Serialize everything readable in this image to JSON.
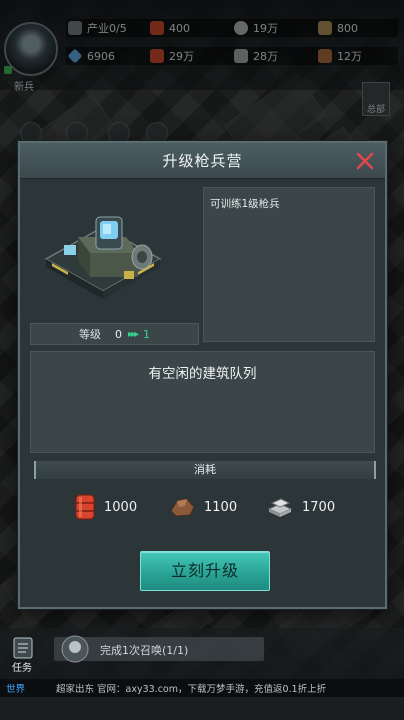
{
  "hud": {
    "avatar_label": "新兵",
    "resources_row1": [
      {
        "icon": "industry-icon",
        "value": "产业0/5",
        "color": "#9aa6a8"
      },
      {
        "icon": "oil-icon",
        "value": "400",
        "color": "#c9492e"
      },
      {
        "icon": "ore-icon",
        "value": "19万",
        "color": "#b0b4b2"
      },
      {
        "icon": "supply-icon",
        "value": "800",
        "color": "#a98c54"
      }
    ],
    "resources_row2": [
      {
        "icon": "gem-icon",
        "value": "6906",
        "color": "#5aa7e0"
      },
      {
        "icon": "fuel-icon",
        "value": "29万",
        "color": "#c9492e"
      },
      {
        "icon": "steel-icon",
        "value": "28万",
        "color": "#a3a8a8"
      },
      {
        "icon": "copper-icon",
        "value": "12万",
        "color": "#a8663c"
      }
    ],
    "hq_label": "总部"
  },
  "dialog": {
    "title": "升级枪兵营",
    "building_image": "rifle-barracks-building",
    "level_label": "等级",
    "current_level": "0",
    "next_level": "1",
    "description": "可训练1级枪兵",
    "status_message": "有空闲的建筑队列",
    "cost_title": "消耗",
    "costs": [
      {
        "icon": "oil-barrel-icon",
        "value": "1000",
        "color": "#d8452c"
      },
      {
        "icon": "ore-icon",
        "value": "1100",
        "color": "#8a5a3a"
      },
      {
        "icon": "steel-ingot-icon",
        "value": "1700",
        "color": "#c4c8c8"
      }
    ],
    "upgrade_button": "立刻升级"
  },
  "bottom": {
    "task_label": "任务",
    "quest_text": "完成1次召唤(1/1)",
    "news_tag": "世界",
    "news_text": "超家出东 官网：axy33.com，下载万梦手游，充值返0.1折上折"
  },
  "colors": {
    "accent_button": "#2aa597",
    "close_x": "#e04848",
    "level_next": "#35d38e"
  }
}
